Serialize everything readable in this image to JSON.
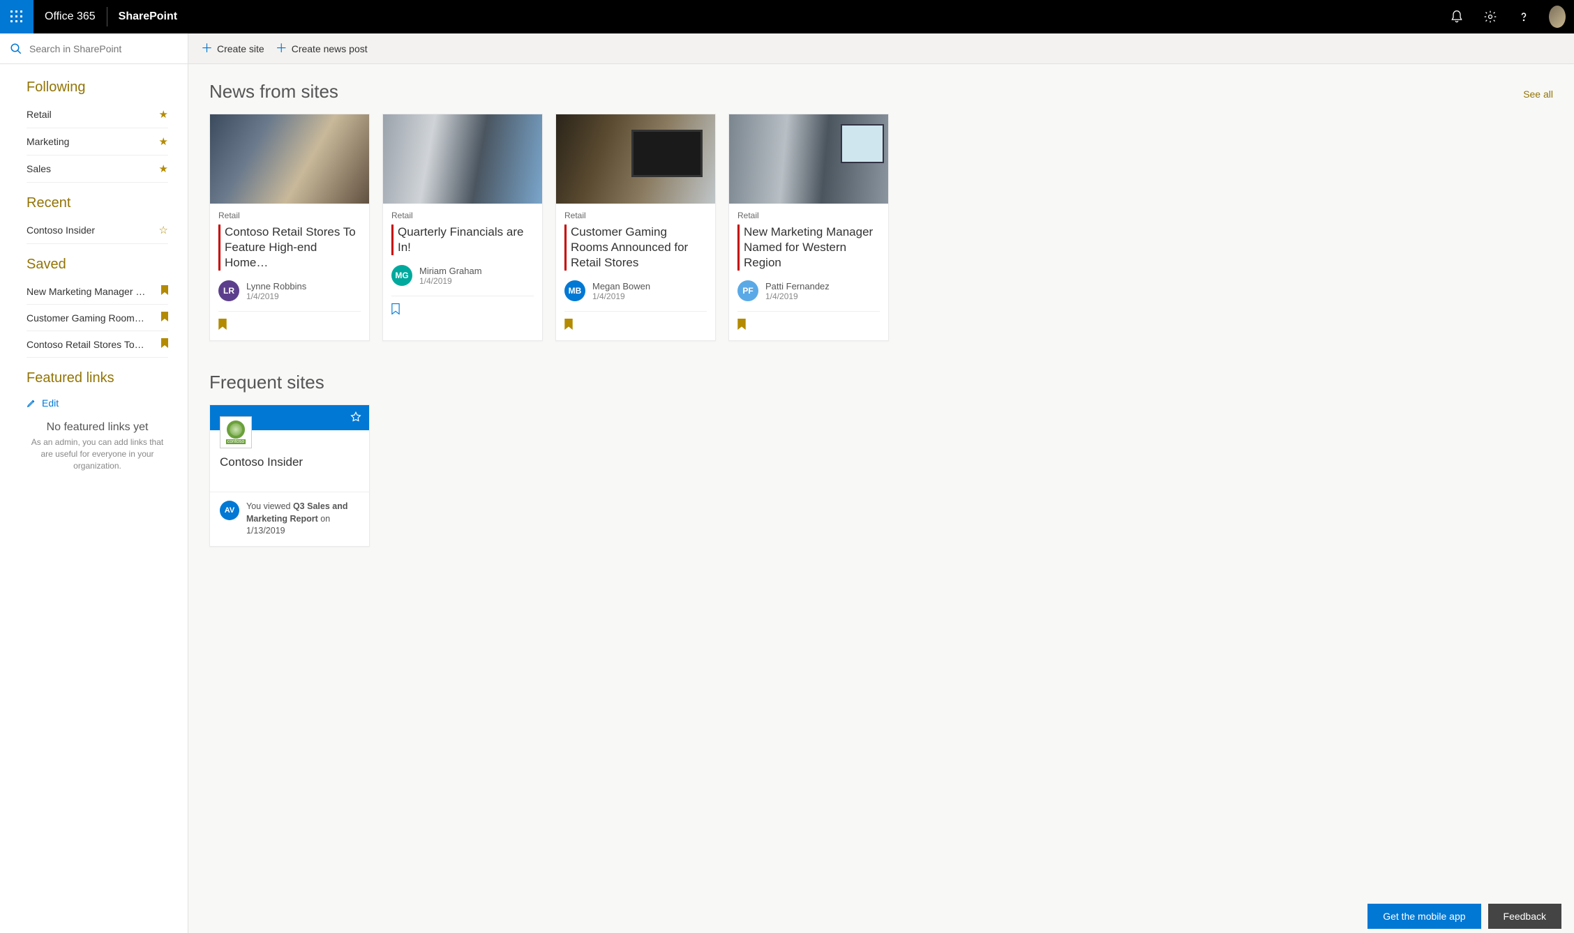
{
  "suite": {
    "product": "Office 365",
    "app": "SharePoint"
  },
  "search": {
    "placeholder": "Search in SharePoint"
  },
  "commands": {
    "create_site": "Create site",
    "create_news": "Create news post"
  },
  "sidebar": {
    "following": {
      "heading": "Following",
      "items": [
        {
          "label": "Retail",
          "starred": true
        },
        {
          "label": "Marketing",
          "starred": true
        },
        {
          "label": "Sales",
          "starred": true
        }
      ]
    },
    "recent": {
      "heading": "Recent",
      "items": [
        {
          "label": "Contoso Insider",
          "starred": false
        }
      ]
    },
    "saved": {
      "heading": "Saved",
      "items": [
        {
          "label": "New Marketing Manager N…"
        },
        {
          "label": "Customer Gaming Rooms A…"
        },
        {
          "label": "Contoso Retail Stores To Fea…"
        }
      ]
    },
    "featured": {
      "heading": "Featured links",
      "edit": "Edit",
      "empty_title": "No featured links yet",
      "empty_body": "As an admin, you can add links that are useful for everyone in your organization."
    }
  },
  "news": {
    "heading": "News from sites",
    "see_all": "See all",
    "cards": [
      {
        "category": "Retail",
        "title": "Contoso Retail Stores To Feature High-end Home…",
        "author": "Lynne Robbins",
        "initials": "LR",
        "avatar_color": "#5c3f8c",
        "date": "1/4/2019",
        "saved": true
      },
      {
        "category": "Retail",
        "title": "Quarterly Financials are In!",
        "author": "Miriam Graham",
        "initials": "MG",
        "avatar_color": "#00a99d",
        "date": "1/4/2019",
        "saved": false
      },
      {
        "category": "Retail",
        "title": "Customer Gaming Rooms Announced for Retail Stores",
        "author": "Megan Bowen",
        "initials": "MB",
        "avatar_color": "#0078d4",
        "date": "1/4/2019",
        "saved": true
      },
      {
        "category": "Retail",
        "title": "New Marketing Manager Named for Western Region",
        "author": "Patti Fernandez",
        "initials": "PF",
        "avatar_color": "#5aa9e6",
        "date": "1/4/2019",
        "saved": true
      }
    ]
  },
  "frequent": {
    "heading": "Frequent sites",
    "site": {
      "name": "Contoso Insider",
      "logo_text": "contoso",
      "activity_prefix": "You viewed ",
      "activity_item": "Q3 Sales and Marketing Report",
      "activity_suffix": " on 1/13/2019",
      "activity_initials": "AV"
    }
  },
  "footer": {
    "mobile": "Get the mobile app",
    "feedback": "Feedback"
  }
}
